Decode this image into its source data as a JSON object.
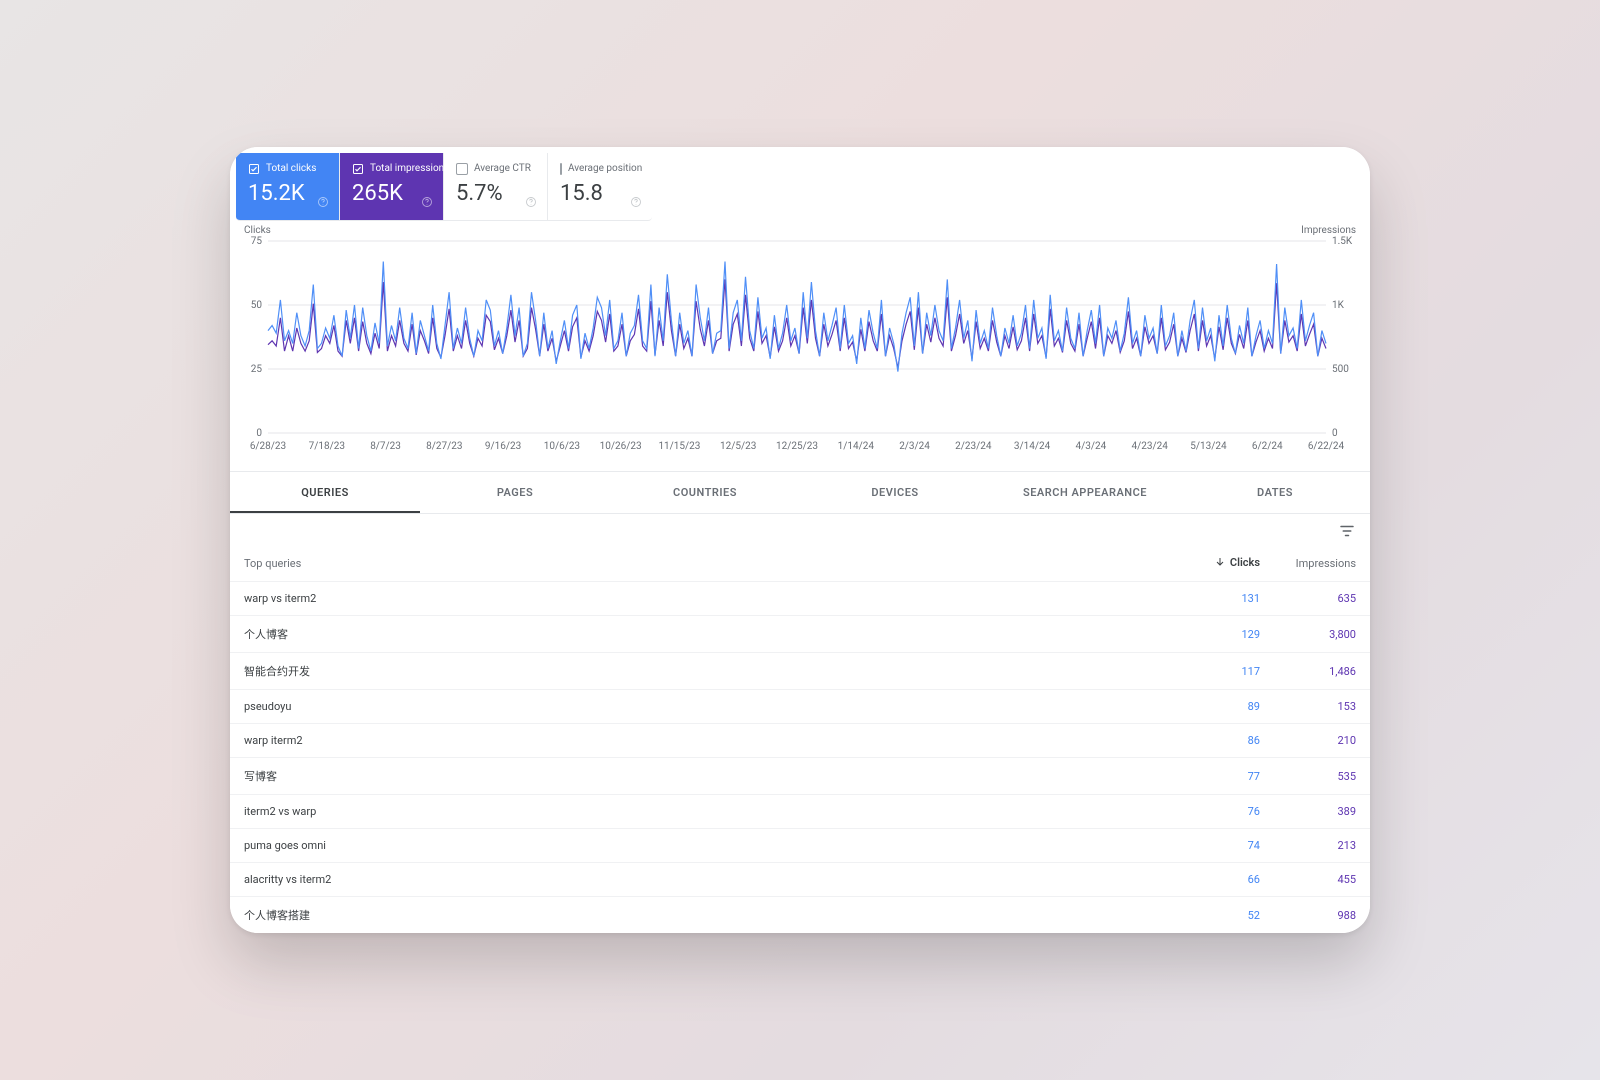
{
  "metrics": {
    "clicks": {
      "label": "Total clicks",
      "value": "15.2K",
      "active": true
    },
    "impressions": {
      "label": "Total impressions",
      "value": "265K",
      "active": true
    },
    "ctr": {
      "label": "Average CTR",
      "value": "5.7%",
      "active": false
    },
    "position": {
      "label": "Average position",
      "value": "15.8",
      "active": false
    }
  },
  "chart": {
    "left_axis_label": "Clicks",
    "right_axis_label": "Impressions",
    "left_ticks": [
      "75",
      "50",
      "25",
      "0"
    ],
    "right_ticks": [
      "1.5K",
      "1K",
      "500",
      "0"
    ]
  },
  "tabs": [
    "QUERIES",
    "PAGES",
    "COUNTRIES",
    "DEVICES",
    "SEARCH APPEARANCE",
    "DATES"
  ],
  "active_tab": "QUERIES",
  "table": {
    "header": {
      "query": "Top queries",
      "clicks": "Clicks",
      "impressions": "Impressions"
    },
    "rows": [
      {
        "query": "warp vs iterm2",
        "clicks": "131",
        "impressions": "635"
      },
      {
        "query": "个人博客",
        "clicks": "129",
        "impressions": "3,800"
      },
      {
        "query": "智能合约开发",
        "clicks": "117",
        "impressions": "1,486"
      },
      {
        "query": "pseudoyu",
        "clicks": "89",
        "impressions": "153"
      },
      {
        "query": "warp iterm2",
        "clicks": "86",
        "impressions": "210"
      },
      {
        "query": "写博客",
        "clicks": "77",
        "impressions": "535"
      },
      {
        "query": "iterm2 vs warp",
        "clicks": "76",
        "impressions": "389"
      },
      {
        "query": "puma goes omni",
        "clicks": "74",
        "impressions": "213"
      },
      {
        "query": "alacritty vs iterm2",
        "clicks": "66",
        "impressions": "455"
      },
      {
        "query": "个人博客搭建",
        "clicks": "52",
        "impressions": "988"
      }
    ]
  },
  "chart_data": {
    "type": "line",
    "xlabel": "",
    "ylabel_left": "Clicks",
    "ylabel_right": "Impressions",
    "ylim_left": [
      0,
      75
    ],
    "ylim_right": [
      0,
      1500
    ],
    "x_dates": [
      "6/28/23",
      "7/18/23",
      "8/7/23",
      "8/27/23",
      "9/16/23",
      "10/6/23",
      "10/26/23",
      "11/15/23",
      "12/5/23",
      "12/25/23",
      "1/14/24",
      "2/3/24",
      "2/23/24",
      "3/14/24",
      "4/3/24",
      "4/23/24",
      "5/13/24",
      "6/2/24",
      "6/22/24"
    ],
    "series": [
      {
        "name": "Clicks",
        "axis": "left",
        "color": "#4f8ff7",
        "values": [
          40,
          42,
          39,
          52,
          36,
          40,
          35,
          47,
          38,
          34,
          40,
          58,
          33,
          35,
          41,
          37,
          46,
          34,
          30,
          48,
          37,
          50,
          33,
          49,
          38,
          32,
          43,
          35,
          67,
          34,
          42,
          36,
          49,
          37,
          33,
          47,
          31,
          44,
          38,
          32,
          50,
          35,
          29,
          42,
          55,
          33,
          41,
          35,
          49,
          37,
          30,
          40,
          36,
          52,
          48,
          34,
          40,
          31,
          41,
          54,
          38,
          49,
          30,
          35,
          55,
          44,
          30,
          47,
          33,
          40,
          27,
          36,
          44,
          33,
          46,
          50,
          29,
          39,
          33,
          41,
          53,
          49,
          38,
          52,
          33,
          36,
          47,
          30,
          39,
          42,
          54,
          36,
          33,
          58,
          30,
          49,
          36,
          62,
          44,
          30,
          47,
          35,
          40,
          30,
          58,
          45,
          36,
          49,
          31,
          39,
          40,
          67,
          33,
          47,
          52,
          36,
          61,
          40,
          33,
          53,
          37,
          41,
          29,
          46,
          33,
          39,
          50,
          36,
          41,
          31,
          55,
          37,
          59,
          40,
          30,
          47,
          36,
          42,
          49,
          33,
          50,
          35,
          38,
          27,
          45,
          33,
          48,
          39,
          33,
          52,
          30,
          41,
          35,
          24,
          39,
          47,
          53,
          34,
          55,
          31,
          47,
          38,
          50,
          40,
          36,
          60,
          33,
          41,
          52,
          37,
          44,
          28,
          48,
          35,
          40,
          33,
          49,
          38,
          30,
          41,
          35,
          46,
          34,
          39,
          50,
          33,
          52,
          37,
          41,
          29,
          54,
          36,
          40,
          32,
          49,
          37,
          33,
          47,
          30,
          40,
          48,
          35,
          50,
          30,
          41,
          37,
          44,
          32,
          39,
          53,
          35,
          40,
          30,
          46,
          37,
          41,
          31,
          50,
          34,
          38,
          47,
          30,
          40,
          32,
          44,
          52,
          33,
          49,
          36,
          41,
          28,
          46,
          34,
          50,
          37,
          31,
          42,
          35,
          49,
          30,
          38,
          44,
          33,
          40,
          35,
          66,
          31,
          49,
          38,
          41,
          33,
          52,
          36,
          42,
          47,
          30,
          40,
          35
        ]
      },
      {
        "name": "Impressions",
        "axis": "right",
        "color": "#5e35b1",
        "values": [
          690,
          720,
          680,
          900,
          640,
          760,
          640,
          820,
          700,
          640,
          720,
          1010,
          630,
          660,
          760,
          700,
          840,
          640,
          600,
          880,
          700,
          900,
          640,
          870,
          700,
          620,
          780,
          660,
          1180,
          640,
          760,
          680,
          880,
          700,
          640,
          850,
          610,
          800,
          720,
          620,
          900,
          660,
          590,
          760,
          970,
          640,
          760,
          660,
          880,
          700,
          600,
          740,
          680,
          920,
          870,
          650,
          740,
          620,
          760,
          960,
          710,
          880,
          600,
          660,
          980,
          810,
          600,
          850,
          640,
          740,
          560,
          680,
          800,
          640,
          830,
          900,
          590,
          720,
          640,
          760,
          950,
          880,
          710,
          930,
          640,
          680,
          850,
          600,
          720,
          770,
          970,
          680,
          640,
          1030,
          610,
          880,
          680,
          1100,
          800,
          600,
          850,
          660,
          740,
          600,
          1030,
          810,
          680,
          880,
          620,
          720,
          740,
          1200,
          640,
          850,
          930,
          680,
          1080,
          740,
          640,
          950,
          700,
          760,
          590,
          830,
          640,
          720,
          900,
          680,
          760,
          620,
          980,
          700,
          1040,
          740,
          600,
          850,
          680,
          770,
          880,
          640,
          900,
          660,
          710,
          560,
          810,
          640,
          870,
          720,
          640,
          930,
          600,
          760,
          660,
          510,
          720,
          850,
          950,
          650,
          980,
          620,
          850,
          710,
          900,
          740,
          680,
          1060,
          640,
          760,
          930,
          700,
          800,
          580,
          870,
          660,
          740,
          640,
          880,
          710,
          600,
          760,
          660,
          830,
          650,
          720,
          900,
          640,
          930,
          700,
          760,
          590,
          970,
          680,
          740,
          630,
          880,
          700,
          640,
          850,
          600,
          740,
          870,
          660,
          900,
          600,
          760,
          700,
          800,
          630,
          720,
          950,
          660,
          740,
          600,
          830,
          700,
          760,
          620,
          900,
          650,
          710,
          850,
          600,
          740,
          630,
          800,
          930,
          640,
          880,
          680,
          760,
          580,
          830,
          650,
          900,
          700,
          620,
          770,
          660,
          880,
          600,
          710,
          800,
          640,
          740,
          660,
          1170,
          620,
          880,
          710,
          760,
          640,
          930,
          680,
          770,
          850,
          600,
          740,
          660
        ]
      }
    ]
  }
}
